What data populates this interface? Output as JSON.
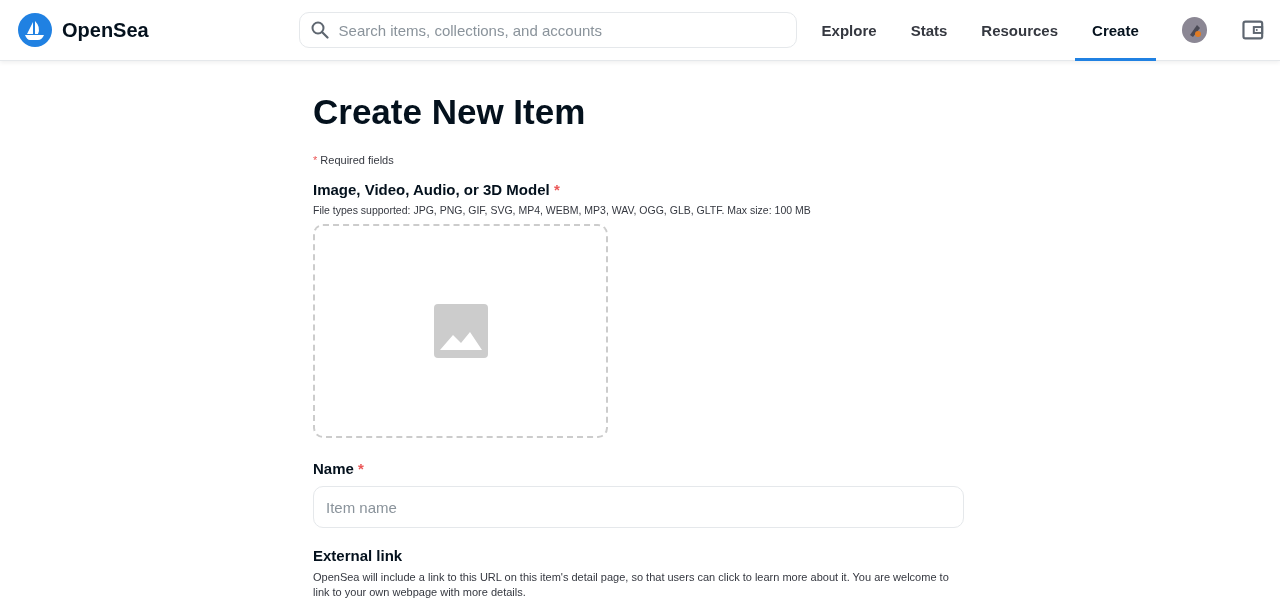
{
  "header": {
    "brand": "OpenSea",
    "search": {
      "placeholder": "Search items, collections, and accounts"
    },
    "nav": [
      {
        "label": "Explore",
        "selected": false
      },
      {
        "label": "Stats",
        "selected": false
      },
      {
        "label": "Resources",
        "selected": false
      },
      {
        "label": "Create",
        "selected": true
      }
    ]
  },
  "page": {
    "title": "Create New Item",
    "required_note": {
      "mark": "*",
      "text": "Required fields"
    },
    "media": {
      "label": "Image, Video, Audio, or 3D Model",
      "mark": "*",
      "hint": "File types supported: JPG, PNG, GIF, SVG, MP4, WEBM, MP3, WAV, OGG, GLB, GLTF. Max size: 100 MB"
    },
    "name": {
      "label": "Name",
      "mark": "*",
      "placeholder": "Item name"
    },
    "external_link": {
      "label": "External link",
      "description": "OpenSea will include a link to this URL on this item's detail page, so that users can click to learn more about it. You are welcome to link to your own webpage with more details."
    }
  }
}
